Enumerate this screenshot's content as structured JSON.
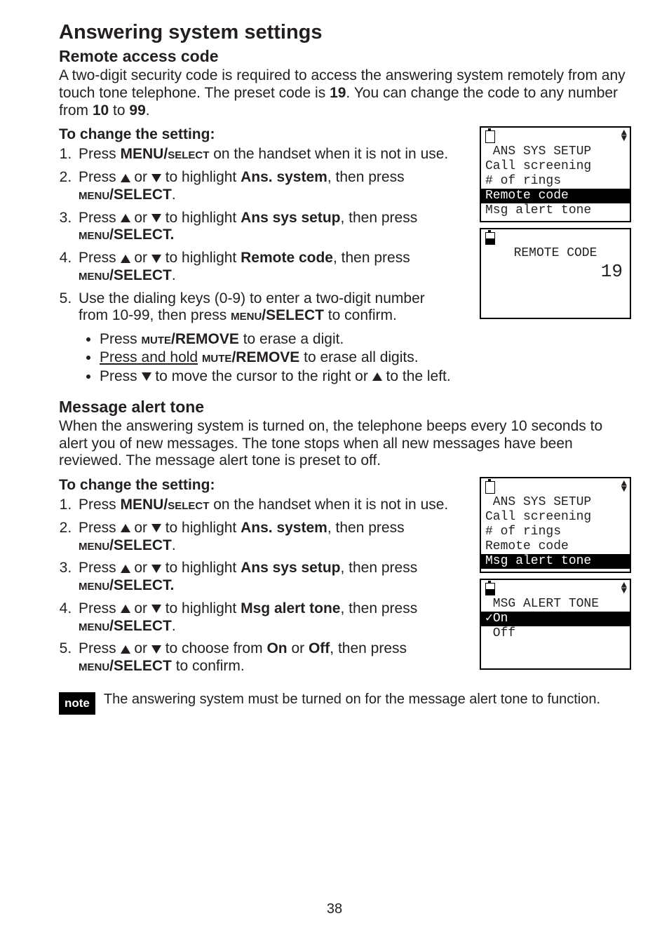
{
  "page": {
    "h1": "Answering system settings",
    "section1": {
      "h2": "Remote access code",
      "intro_parts": [
        "A two-digit security code is required to access the answering system remotely from any touch tone telephone. The preset code is ",
        "19",
        ". You can change the code to any number from ",
        "10",
        " to ",
        "99",
        "."
      ],
      "sub": "To change the setting:",
      "steps": {
        "s1": [
          "Press ",
          "MENU/",
          "select",
          " on the handset when it is not in use."
        ],
        "s2_a": "Press ",
        "s2_b": " or ",
        "s2_c": " to highlight ",
        "s2_d": "Ans. system",
        "s2_e": ", then press ",
        "s2_f": "menu",
        "s2_g": "/SELECT",
        "s2_h": ".",
        "s3_a": "Press ",
        "s3_b": " or ",
        "s3_c": " to highlight ",
        "s3_d": "Ans sys setup",
        "s3_e": ", then press ",
        "s3_f": "menu",
        "s3_g": "/SELECT.",
        "s4_a": "Press  ",
        "s4_b": " or ",
        "s4_c": " to highlight ",
        "s4_d": "Remote code",
        "s4_e": ", then press ",
        "s4_f": "menu",
        "s4_g": "/SELECT",
        "s4_h": ".",
        "s5_a": "Use the dialing keys (0-9) to enter a two-digit number from 10-99, then press ",
        "s5_b": "menu",
        "s5_c": "/SELECT",
        "s5_d": " to confirm.",
        "b1_a": "Press ",
        "b1_b": "mute",
        "b1_c": "/REMOVE",
        "b1_d": " to erase a digit.",
        "b2_a": "Press and hold",
        "b2_b": " ",
        "b2_c": "mute",
        "b2_d": "/REMOVE",
        "b2_e": " to erase all digits.",
        "b3_a": "Press ",
        "b3_b": " to move the cursor to the right or ",
        "b3_c": " to the left."
      }
    },
    "section2": {
      "h2": "Message alert tone",
      "intro": "When the answering system is turned on, the telephone beeps every 10 seconds to alert you of new messages. The tone stops when all new messages have been reviewed. The message alert tone is preset to off.",
      "sub": "To change the setting:",
      "steps": {
        "s1": [
          "Press ",
          "MENU/",
          "select",
          " on the handset when it is not in use."
        ],
        "s2_a": "Press ",
        "s2_b": " or ",
        "s2_c": " to highlight ",
        "s2_d": "Ans. system",
        "s2_e": ", then press ",
        "s2_f": "menu",
        "s2_g": "/SELECT",
        "s2_h": ".",
        "s3_a": "Press ",
        "s3_b": " or ",
        "s3_c": " to highlight ",
        "s3_d": "Ans sys setup",
        "s3_e": ", then press ",
        "s3_f": "menu",
        "s3_g": "/SELECT.",
        "s4_a": "Press  ",
        "s4_b": " or ",
        "s4_c": " to highlight ",
        "s4_d": "Msg alert tone",
        "s4_e": ", then press ",
        "s4_f": "menu",
        "s4_g": "/SELECT",
        "s4_h": ".",
        "s5_a": "Press ",
        "s5_b": " or ",
        "s5_c": " to choose from ",
        "s5_d": "On",
        "s5_e": " or ",
        "s5_f": "Off",
        "s5_g": ", then press ",
        "s5_h": "menu",
        "s5_i": "/SELECT",
        "s5_j": " to confirm."
      }
    },
    "note": {
      "tag": "note",
      "text": "The answering system must be turned on for the message alert tone to function."
    },
    "pagenum": "38"
  },
  "screens": {
    "s1a": {
      "title": " ANS SYS SETUP",
      "r1": "Call screening",
      "r2": "# of rings",
      "r3": "Remote code",
      "r4": "Msg alert tone"
    },
    "s1b": {
      "title": "REMOTE CODE",
      "value": "19"
    },
    "s2a": {
      "title": " ANS SYS SETUP",
      "r1": "Call screening",
      "r2": "# of rings",
      "r3": "Remote code",
      "r4": "Msg alert tone"
    },
    "s2b": {
      "title": " MSG ALERT TONE",
      "r1": "✓On",
      "r2": " Off"
    }
  }
}
